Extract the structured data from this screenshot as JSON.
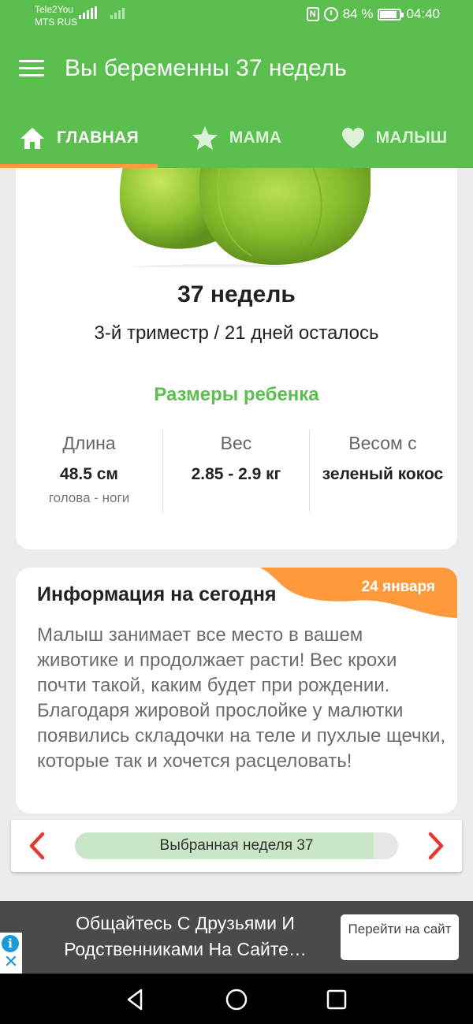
{
  "status_bar": {
    "carrier_1": "Tele2You",
    "carrier_2": "MTS RUS",
    "battery": "84 %",
    "time": "04:40"
  },
  "app_bar": {
    "title": "Вы беременны 37 недель"
  },
  "tabs": [
    {
      "label": "ГЛАВНАЯ",
      "icon": "home-icon",
      "active": true
    },
    {
      "label": "МАМА",
      "icon": "star-icon",
      "active": false
    },
    {
      "label": "МАЛЫШ",
      "icon": "heart-icon",
      "active": false
    }
  ],
  "week_card": {
    "week_title": "37 недель",
    "trimester_line": "3-й триместр / 21 дней осталось",
    "sizes_heading": "Размеры ребенка",
    "stats": [
      {
        "label": "Длина",
        "value": "48.5 см",
        "sub": "голова - ноги"
      },
      {
        "label": "Вес",
        "value": "2.85 - 2.9 кг",
        "sub": ""
      },
      {
        "label": "Весом с",
        "value": "зеленый кокос",
        "sub": ""
      }
    ]
  },
  "info_card": {
    "title": "Информация на сегодня",
    "date": "24 января",
    "body": "Малыш занимает все место в вашем животике и продолжает расти! Вес крохи почти такой, каким будет при рождении. Благодаря жировой прослойке у малютки появились складочки на теле и пухлые щечки, которые так и хочется расцеловать!"
  },
  "week_selector": {
    "label": "Выбранная неделя 37",
    "progress": 0.925
  },
  "ad": {
    "text": "Общайтесь С Друзьями И Родственниками На Сайте…",
    "button_label": "Перейти на сайт"
  },
  "colors": {
    "brand_green": "#5bbf4f",
    "accent_orange": "#ff9a3c",
    "selected_tab_underline": "#ff9a3c"
  }
}
